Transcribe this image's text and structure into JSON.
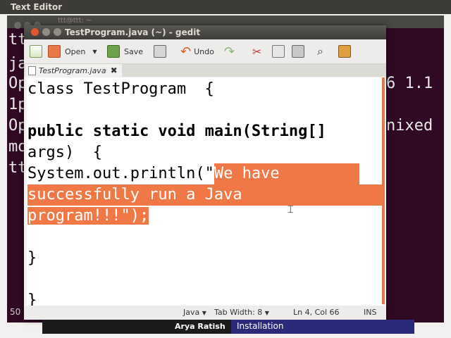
{
  "desktop": {
    "app_title": "Text Editor"
  },
  "terminal": {
    "title": "ttt@ttt: ~",
    "left_lines": [
      "tt",
      "ja",
      "Op",
      "1p",
      "Op",
      "mo",
      "tt"
    ],
    "right_1": "6 1.1",
    "right_2": "nixed",
    "bottom": "50"
  },
  "gedit": {
    "title": "TestProgram.java (~) - gedit",
    "toolbar": {
      "new": "",
      "open": "Open",
      "save": "Save",
      "undo": "Undo"
    },
    "tab": {
      "label": "TestProgram.java"
    },
    "code": {
      "l1": "class TestProgram  {",
      "l2": "public static void main(String[]",
      "l3": "args)  {",
      "l4_a": "System.out.println(\"",
      "l4_b": "We have",
      "l5": "successfully run a Java",
      "l6": "program!!!\");",
      "l7": "}",
      "l8": "}"
    },
    "status": {
      "language": "Java",
      "tab_width": "Tab Width: 8",
      "position": "Ln 4, Col 66",
      "mode": "INS"
    }
  },
  "caption": {
    "name": "Arya Ratish",
    "topic": "Installation"
  },
  "colors": {
    "selection": "#f07746",
    "terminal_bg": "#300a24"
  }
}
